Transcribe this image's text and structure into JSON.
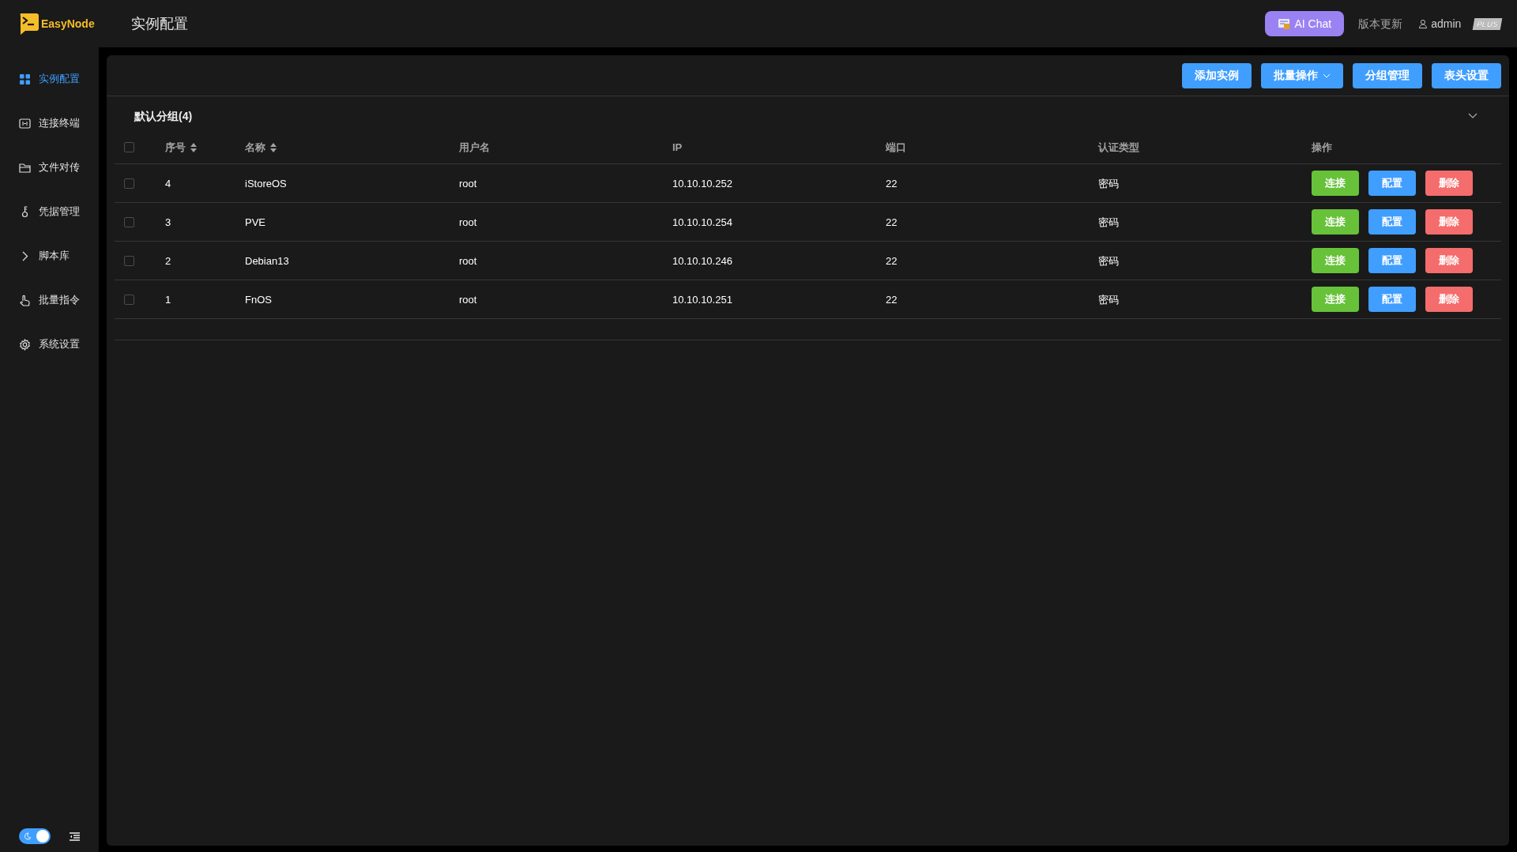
{
  "app": {
    "name": "EasyNode"
  },
  "header": {
    "title": "实例配置",
    "ai_chat": "AI Chat",
    "update": "版本更新",
    "user": "admin",
    "plan": "PLUS"
  },
  "sidebar": {
    "items": [
      {
        "label": "实例配置",
        "selected": true
      },
      {
        "label": "连接终端",
        "selected": false
      },
      {
        "label": "文件对传",
        "selected": false
      },
      {
        "label": "凭据管理",
        "selected": false
      },
      {
        "label": "脚本库",
        "selected": false
      },
      {
        "label": "批量指令",
        "selected": false
      },
      {
        "label": "系统设置",
        "selected": false
      }
    ],
    "theme_toggle": {
      "on": true
    }
  },
  "toolbar": [
    {
      "label": "添加实例",
      "kind": "button"
    },
    {
      "label": "批量操作",
      "kind": "dropdown"
    },
    {
      "label": "分组管理",
      "kind": "button"
    },
    {
      "label": "表头设置",
      "kind": "button"
    }
  ],
  "group": {
    "title": "默认分组(4)",
    "expanded": true,
    "table": {
      "all_checked": false,
      "columns": [
        {
          "label": "序号",
          "sortable": true
        },
        {
          "label": "名称",
          "sortable": true
        },
        {
          "label": "用户名",
          "sortable": false
        },
        {
          "label": "IP",
          "sortable": false
        },
        {
          "label": "端口",
          "sortable": false
        },
        {
          "label": "认证类型",
          "sortable": false
        },
        {
          "label": "操作",
          "sortable": false
        }
      ],
      "rows": [
        {
          "checked": false,
          "cells": [
            "4",
            "iStoreOS",
            "root",
            "10.10.10.252",
            "22",
            "密码"
          ],
          "actions": [
            {
              "label": "连接",
              "kind": "connect"
            },
            {
              "label": "配置",
              "kind": "config"
            },
            {
              "label": "删除",
              "kind": "delete"
            }
          ]
        },
        {
          "checked": false,
          "cells": [
            "3",
            "PVE",
            "root",
            "10.10.10.254",
            "22",
            "密码"
          ],
          "actions": [
            {
              "label": "连接",
              "kind": "connect"
            },
            {
              "label": "配置",
              "kind": "config"
            },
            {
              "label": "删除",
              "kind": "delete"
            }
          ]
        },
        {
          "checked": false,
          "cells": [
            "2",
            "Debian13",
            "root",
            "10.10.10.246",
            "22",
            "密码"
          ],
          "actions": [
            {
              "label": "连接",
              "kind": "connect"
            },
            {
              "label": "配置",
              "kind": "config"
            },
            {
              "label": "删除",
              "kind": "delete"
            }
          ]
        },
        {
          "checked": false,
          "cells": [
            "1",
            "FnOS",
            "root",
            "10.10.10.251",
            "22",
            "密码"
          ],
          "actions": [
            {
              "label": "连接",
              "kind": "connect"
            },
            {
              "label": "配置",
              "kind": "config"
            },
            {
              "label": "删除",
              "kind": "delete"
            }
          ]
        }
      ]
    }
  }
}
